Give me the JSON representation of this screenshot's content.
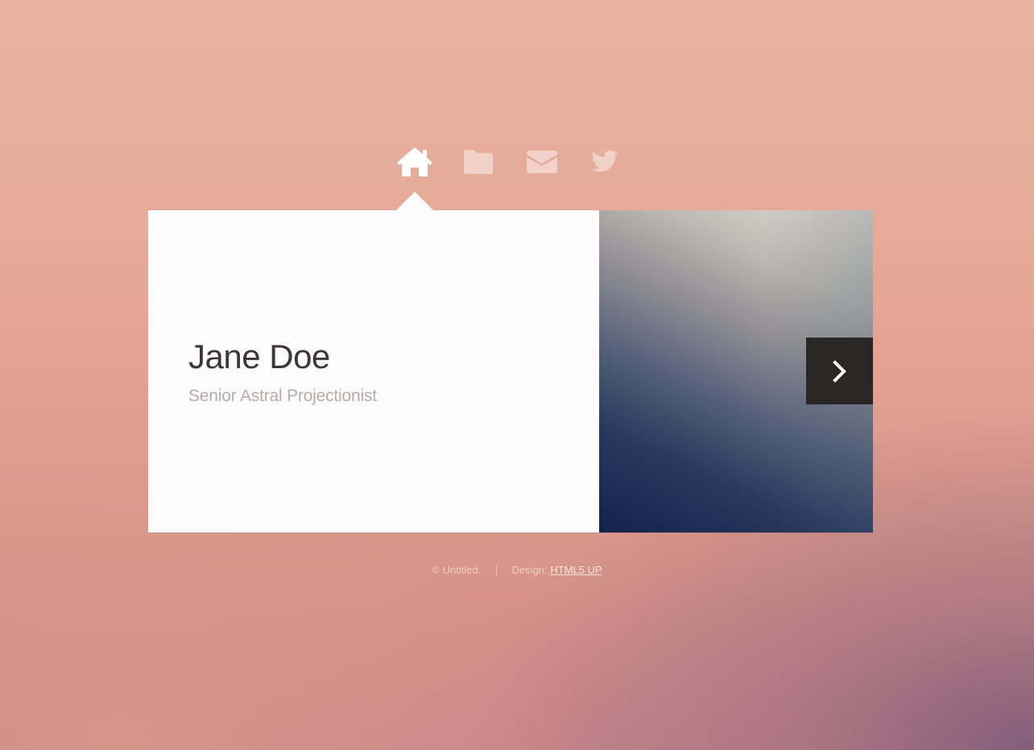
{
  "nav": {
    "items": [
      {
        "icon": "home-icon",
        "active": true
      },
      {
        "icon": "folder-icon",
        "active": false
      },
      {
        "icon": "mail-icon",
        "active": false
      },
      {
        "icon": "twitter-icon",
        "active": false
      }
    ]
  },
  "card": {
    "name": "Jane Doe",
    "role": "Senior Astral Projectionist",
    "next_icon": "chevron-right-icon"
  },
  "footer": {
    "copyright": "© Untitled.",
    "design_label": "Design:",
    "design_link": "HTML5 UP"
  },
  "colors": {
    "card_bg": "#fdfbfb",
    "title": "#3a3838",
    "subtitle": "#b2aeae",
    "next_button": "#2a2626",
    "nav_active": "#ffffff",
    "nav_inactive": "rgba(255,255,255,0.45)"
  }
}
